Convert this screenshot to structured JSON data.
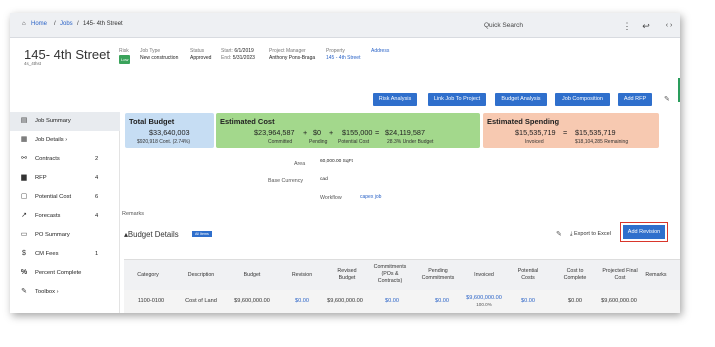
{
  "breadcrumb": {
    "home": "Home",
    "sep1": "/",
    "jobs": "Jobs",
    "sep2": "/",
    "current": "145- 4th Street"
  },
  "topbar": {
    "search_label": "Quick Search",
    "menu_icon": "vertical-dots-icon",
    "back_icon": "back-arrow-icon",
    "nav_icon": "chevron-left-right-icon"
  },
  "project": {
    "title": "145- 4th Street",
    "code": "4s_4thst",
    "risk_label": "Risk",
    "risk_value": "Low",
    "jobtype_label": "Job Type",
    "jobtype_value": "New construction",
    "status_label": "Status",
    "status_value": "Approved",
    "start_label": "Start:",
    "start_value": "6/1/2019",
    "end_label": "End:",
    "end_value": "5/31/2023",
    "pm_label": "Project Manager",
    "pm_value": "Anthony Pons-Braga",
    "property_label": "Property",
    "property_value": "145 - 4th Street",
    "address_label": "Address"
  },
  "actions": [
    "Risk Analysis",
    "Link Job To Project",
    "Budget Analysis",
    "Job Composition",
    "Add RFP"
  ],
  "sidebar": [
    {
      "label": "Job Summary",
      "count": "",
      "icon": "summary-icon",
      "active": true
    },
    {
      "label": "Job Details ›",
      "count": "",
      "icon": "details-icon"
    },
    {
      "label": "Contracts",
      "count": "2",
      "icon": "handshake-icon"
    },
    {
      "label": "RFP",
      "count": "4",
      "icon": "document-icon"
    },
    {
      "label": "Potential Cost",
      "count": "6",
      "icon": "clipboard-icon"
    },
    {
      "label": "Forecasts",
      "count": "4",
      "icon": "chart-icon"
    },
    {
      "label": "PO Summary",
      "count": "",
      "icon": "list-icon"
    },
    {
      "label": "CM Fees",
      "count": "1",
      "icon": "dollar-icon"
    },
    {
      "label": "Percent Complete",
      "count": "",
      "icon": "percent-icon"
    },
    {
      "label": "Toolbox ›",
      "count": "",
      "icon": "wrench-icon"
    }
  ],
  "cards": {
    "budget": {
      "title": "Total Budget",
      "amount": "$33,640,003",
      "sub": "$920,918 Cont. (2.74%)",
      "color": "#c6ddf3"
    },
    "cost": {
      "title": "Estimated Cost",
      "a1": "$23,964,587",
      "op1": "+",
      "a2": "$0",
      "op2": "+",
      "a3": "$155,000",
      "op3": "=",
      "a4": "$24,119,587",
      "l1": "Committed",
      "l2": "Pending",
      "l3": "Potential Cost",
      "l4": "28.3% Under Budget",
      "color": "#a3d88c"
    },
    "spend": {
      "title": "Estimated Spending",
      "a1": "$15,535,719",
      "op": "=",
      "a2": "$15,535,719",
      "l1": "Invoiced",
      "l2": "$18,104,285 Remaining",
      "color": "#f7c9b1"
    }
  },
  "info": {
    "area_label": "Area",
    "area_value": "60,000.00 SqFt",
    "currency_label": "Base Currency",
    "currency_value": "cad",
    "workflow_label": "Workflow",
    "workflow_value": "capex job"
  },
  "remarks_label": "Remarks",
  "budget_details": {
    "title": "Budget Details",
    "all_items": "All Items",
    "export": "Export to Excel",
    "add_revision": "Add Revision"
  },
  "table": {
    "headers": [
      "Category",
      "Description",
      "Budget",
      "Revision",
      "Revised Budget",
      "Commitments (POs & Contracts)",
      "Pending Commitments",
      "Invoiced",
      "Potential Costs",
      "Cost to Complete",
      "Projected Final Cost",
      "Remarks"
    ],
    "row": [
      "1100-0100",
      "Cost of Land",
      "$9,600,000.00",
      "$0.00",
      "$9,600,000.00",
      "$0.00",
      "$0.00",
      "$9,600,000.00",
      "$0.00",
      "$0.00",
      "$9,600,000.00",
      ""
    ],
    "row_sub": "100.0%"
  }
}
